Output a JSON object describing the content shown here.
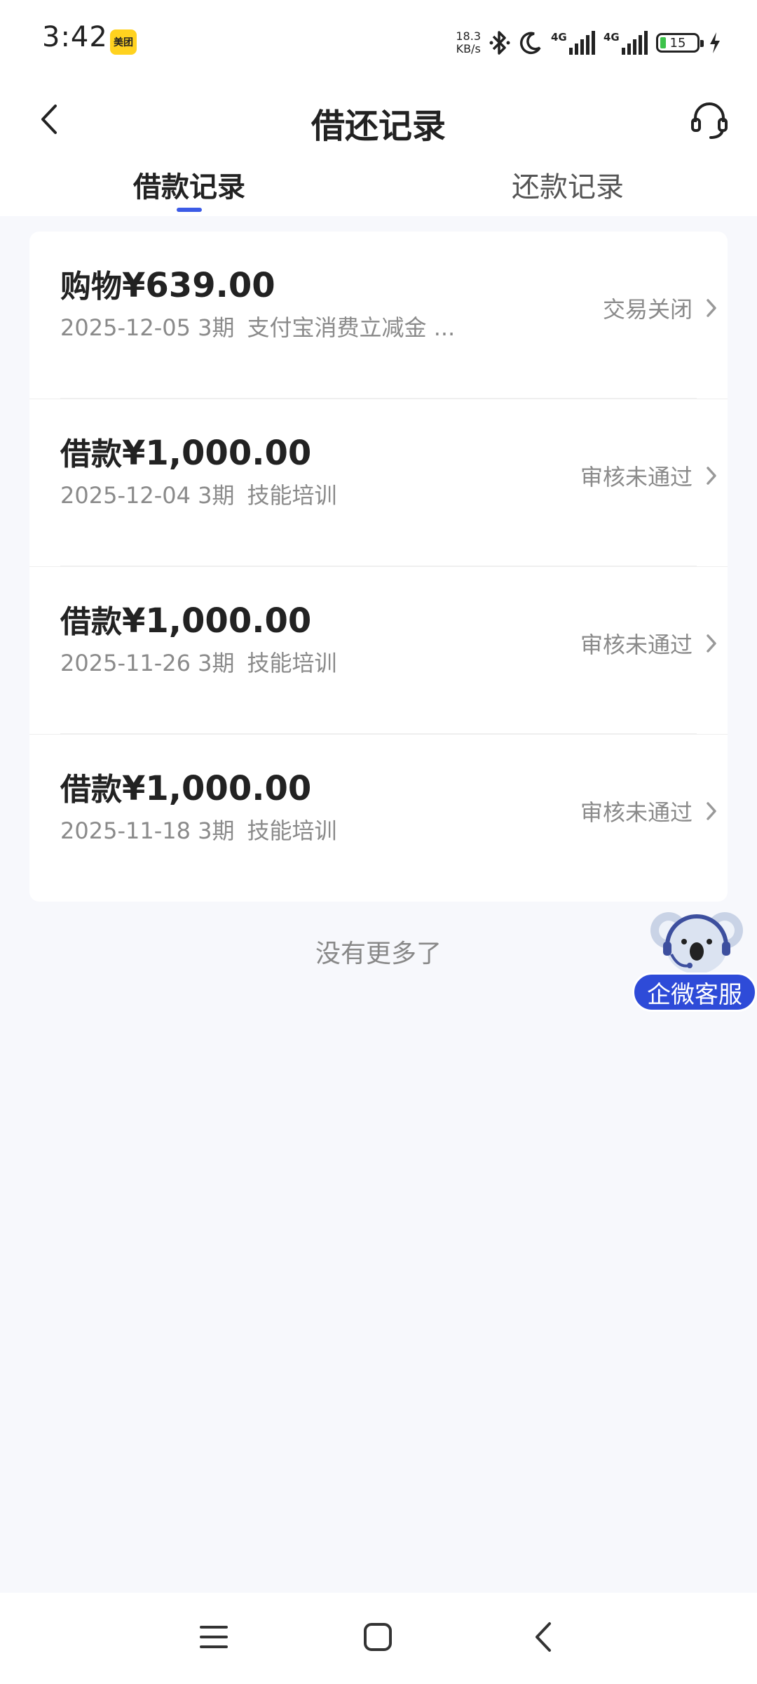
{
  "status_bar": {
    "time": "3:42",
    "app_badge": "美团",
    "net_speed_value": "18.3",
    "net_speed_unit": "KB/s",
    "signal_1": "4G",
    "signal_2": "4G",
    "battery": "15"
  },
  "header": {
    "title": "借还记录"
  },
  "tabs": [
    {
      "label": "借款记录",
      "active": true
    },
    {
      "label": "还款记录",
      "active": false
    }
  ],
  "records": [
    {
      "type": "购物",
      "amount": "¥639.00",
      "date": "2025-12-05",
      "term": "3期",
      "purpose": "支付宝消费立减金 ...",
      "status": "交易关闭"
    },
    {
      "type": "借款",
      "amount": "¥1,000.00",
      "date": "2025-12-04",
      "term": "3期",
      "purpose": "技能培训",
      "status": "审核未通过"
    },
    {
      "type": "借款",
      "amount": "¥1,000.00",
      "date": "2025-11-26",
      "term": "3期",
      "purpose": "技能培训",
      "status": "审核未通过"
    },
    {
      "type": "借款",
      "amount": "¥1,000.00",
      "date": "2025-11-18",
      "term": "3期",
      "purpose": "技能培训",
      "status": "审核未通过"
    }
  ],
  "footer_text": "没有更多了",
  "floating_service": {
    "label": "企微客服"
  },
  "colors": {
    "accent": "#3c5be6",
    "background": "#f7f8fc",
    "muted_text": "#8a8a8a",
    "float_button": "#2e4bd8"
  },
  "icons": [
    "back-arrow-icon",
    "headset-icon",
    "chevron-right-icon",
    "bluetooth-icon",
    "moon-icon",
    "koala-mascot-icon",
    "menu-icon",
    "home-icon",
    "system-back-icon"
  ]
}
